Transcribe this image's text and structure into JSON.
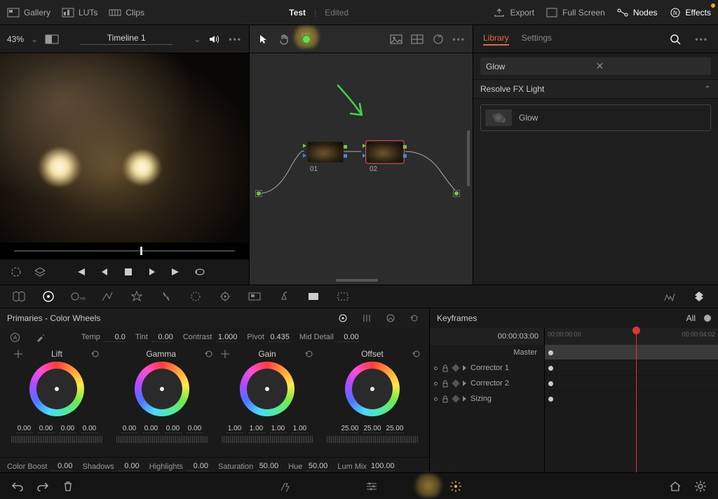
{
  "topbar": {
    "gallery": "Gallery",
    "luts": "LUTs",
    "clips": "Clips",
    "project": "Test",
    "status": "Edited",
    "export": "Export",
    "fullscreen": "Full Screen",
    "nodes": "Nodes",
    "effects": "Effects"
  },
  "row2": {
    "zoom": "43%",
    "timeline": "Timeline 1",
    "library": "Library",
    "settings": "Settings"
  },
  "library": {
    "search": "Glow",
    "group": "Resolve FX Light",
    "item": "Glow"
  },
  "nodes": {
    "n1": "01",
    "n2": "02"
  },
  "primaries": {
    "title": "Primaries - Color Wheels",
    "temp_lbl": "Temp",
    "temp_val": "0.0",
    "tint_lbl": "Tint",
    "tint_val": "0.00",
    "contrast_lbl": "Contrast",
    "contrast_val": "1.000",
    "pivot_lbl": "Pivot",
    "pivot_val": "0.435",
    "md_lbl": "Mid Detail",
    "md_val": "0.00",
    "wheels": [
      {
        "name": "Lift",
        "vals": [
          "0.00",
          "0.00",
          "0.00",
          "0.00"
        ]
      },
      {
        "name": "Gamma",
        "vals": [
          "0.00",
          "0.00",
          "0.00",
          "0.00"
        ]
      },
      {
        "name": "Gain",
        "vals": [
          "1.00",
          "1.00",
          "1.00",
          "1.00"
        ]
      },
      {
        "name": "Offset",
        "vals": [
          "25.00",
          "25.00",
          "25.00"
        ]
      }
    ],
    "colorboost_lbl": "Color Boost",
    "colorboost_val": "0.00",
    "shadows_lbl": "Shadows",
    "shadows_val": "0.00",
    "highlights_lbl": "Highlights",
    "highlights_val": "0.00",
    "saturation_lbl": "Saturation",
    "saturation_val": "50.00",
    "hue_lbl": "Hue",
    "hue_val": "50.00",
    "lummix_lbl": "Lum Mix",
    "lummix_val": "100.00"
  },
  "keyframes": {
    "title": "Keyframes",
    "all": "All",
    "tc": "00:00:03:00",
    "ruler": [
      "00:00:00:00",
      "00:00:04:02"
    ],
    "rows": [
      "Master",
      "Corrector 1",
      "Corrector 2",
      "Sizing"
    ]
  }
}
